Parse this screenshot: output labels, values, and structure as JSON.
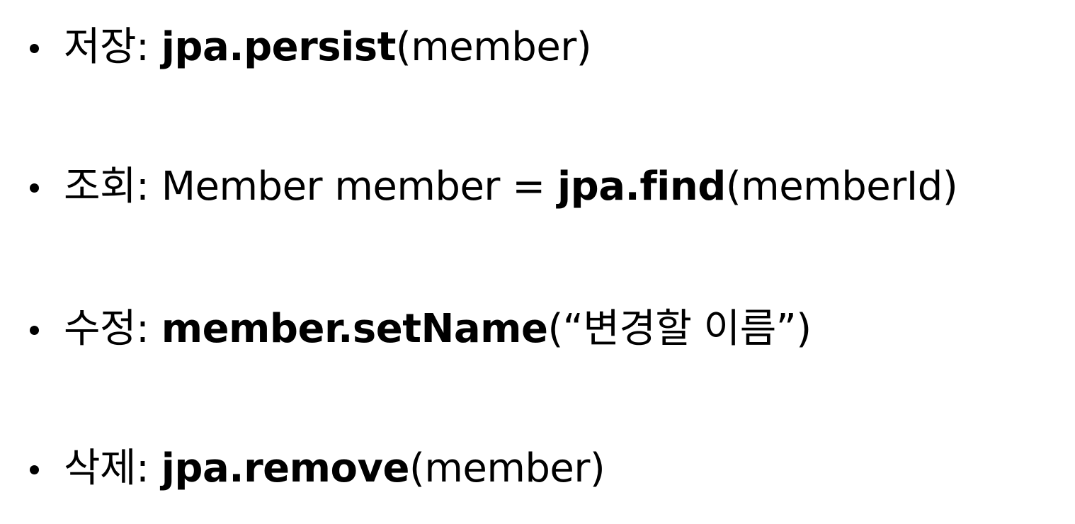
{
  "items": [
    {
      "label": "저장: ",
      "code_bold": "jpa.persist",
      "code_rest": "(member)"
    },
    {
      "label": "조회: ",
      "code_prefix": "Member member = ",
      "code_bold": "jpa.find",
      "code_rest": "(memberId)"
    },
    {
      "label": "수정: ",
      "code_bold": "member.setName",
      "code_rest": "(“변경할 이름”)"
    },
    {
      "label": "삭제: ",
      "code_bold": "jpa.remove",
      "code_rest": "(member)"
    }
  ]
}
